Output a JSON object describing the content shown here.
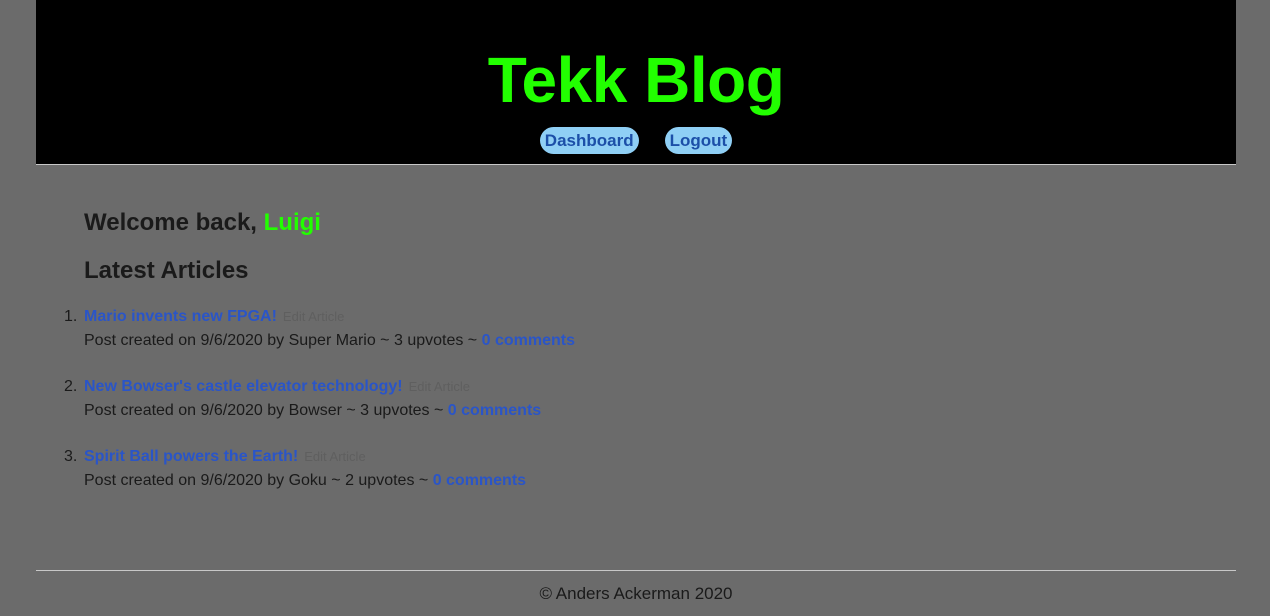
{
  "header": {
    "title": "Tekk Blog",
    "nav": [
      {
        "label": "Dashboard"
      },
      {
        "label": "Logout"
      }
    ]
  },
  "main": {
    "welcome_prefix": "Welcome back,",
    "username": "Luigi",
    "latest_heading": "Latest Articles",
    "articles": [
      {
        "number": "1.",
        "title": "Mario invents new FPGA!",
        "faint": "Edit Article",
        "meta_prefix": "Post created on 9/6/2020 by Super Mario ~ 3 upvotes ~",
        "comments": "0 comments"
      },
      {
        "number": "2.",
        "title": "New Bowser's castle elevator technology!",
        "faint": "Edit Article",
        "meta_prefix": "Post created on 9/6/2020 by Bowser ~ 3 upvotes ~",
        "comments": "0 comments"
      },
      {
        "number": "3.",
        "title": "Spirit Ball powers the Earth!",
        "faint": "Edit Article",
        "meta_prefix": "Post created on 9/6/2020 by Goku ~ 2 upvotes ~",
        "comments": "0 comments"
      }
    ]
  },
  "footer": {
    "copyright": "© Anders Ackerman 2020"
  },
  "colors": {
    "background": "#6b6b6b",
    "header_bg": "#000000",
    "accent_green": "#22ff00",
    "link_blue": "#2a55c8",
    "nav_button_bg": "#8fcff5"
  }
}
